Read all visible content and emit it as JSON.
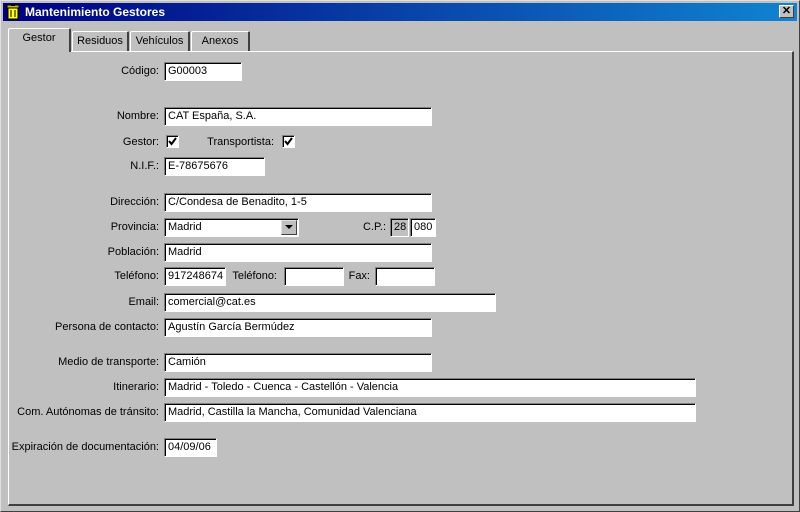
{
  "window": {
    "title": "Mantenimiento Gestores",
    "title_icon": "trash-bin-icon",
    "close_icon": "close-icon",
    "close_glyph": "✕"
  },
  "tabs": [
    "Gestor",
    "Residuos",
    "Vehículos",
    "Anexos"
  ],
  "form": {
    "codigo": {
      "label": "Código:",
      "value": "G00003"
    },
    "nombre": {
      "label": "Nombre:",
      "value": "CAT España, S.A."
    },
    "gestor": {
      "label": "Gestor:",
      "checked": true
    },
    "transportista": {
      "label": "Transportista:",
      "checked": true
    },
    "nif": {
      "label": "N.I.F.:",
      "value": "E-78675676"
    },
    "direccion": {
      "label": "Dirección:",
      "value": "C/Condesa de Benadito, 1-5"
    },
    "provincia": {
      "label": "Provincia:",
      "value": "Madrid"
    },
    "cp": {
      "label": "C.P.:",
      "prefix": "28",
      "value": "080"
    },
    "poblacion": {
      "label": "Población:",
      "value": "Madrid"
    },
    "telefono1": {
      "label": "Teléfono:",
      "value": "917248674"
    },
    "telefono2": {
      "label": "Teléfono:",
      "value": ""
    },
    "fax": {
      "label": "Fax:",
      "value": ""
    },
    "email": {
      "label": "Email:",
      "value": "comercial@cat.es"
    },
    "contacto": {
      "label": "Persona de contacto:",
      "value": "Agustín García Bermúdez"
    },
    "transporte": {
      "label": "Medio de transporte:",
      "value": "Camión"
    },
    "itinerario": {
      "label": "Itinerario:",
      "value": "Madrid - Toledo - Cuenca - Castellón - Valencia"
    },
    "comunidades": {
      "label": "Com. Autónomas de tránsito:",
      "value": "Madrid, Castilla la Mancha, Comunidad Valenciana"
    },
    "expiracion": {
      "label": "Expiración de documentación:",
      "value": "04/09/06"
    }
  },
  "colors": {
    "titlebar_start": "#000080",
    "titlebar_end": "#1084d0",
    "face": "#c0c0c0"
  }
}
